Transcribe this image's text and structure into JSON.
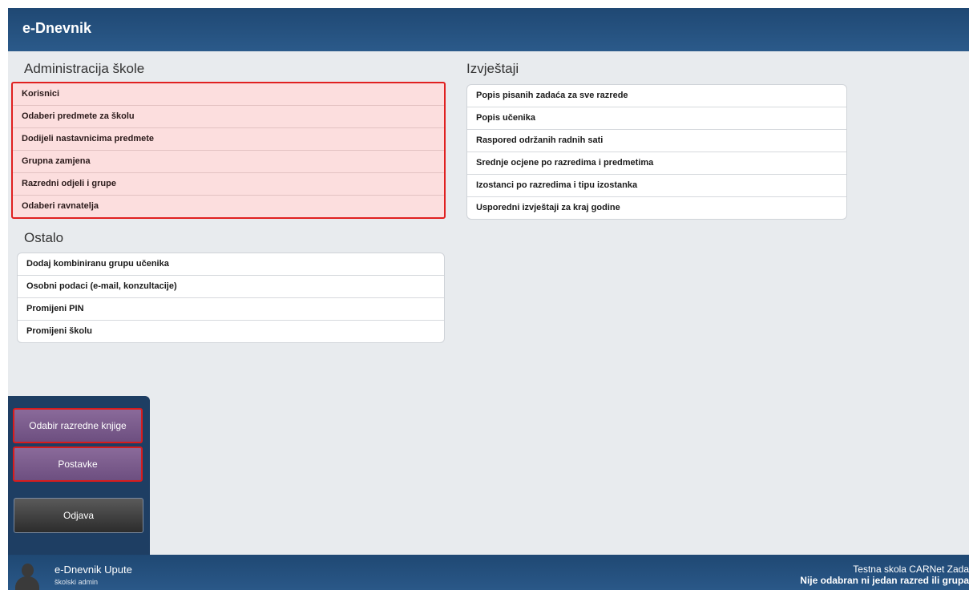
{
  "header": {
    "title": "e-Dnevnik"
  },
  "administracija": {
    "title": "Administracija škole",
    "items": [
      "Korisnici",
      "Odaberi predmete za školu",
      "Dodijeli nastavnicima predmete",
      "Grupna zamjena",
      "Razredni odjeli i grupe",
      "Odaberi ravnatelja"
    ]
  },
  "ostalo": {
    "title": "Ostalo",
    "items": [
      "Dodaj kombiniranu grupu učenika",
      "Osobni podaci (e-mail, konzultacije)",
      "Promijeni PIN",
      "Promijeni školu"
    ]
  },
  "izvjestaji": {
    "title": "Izvještaji",
    "items": [
      "Popis pisanih zadaća za sve razrede",
      "Popis učenika",
      "Raspored održanih radnih sati",
      "Srednje ocjene po razredima i predmetima",
      "Izostanci po razredima i tipu izostanka",
      "Usporedni izvještaji za kraj godine"
    ]
  },
  "sidebar": {
    "odabir_label": "Odabir razredne knjige",
    "postavke_label": "Postavke",
    "odjava_label": "Odjava"
  },
  "footer": {
    "user_name": "e-Dnevnik Upute",
    "user_role": "školski admin",
    "school": "Testna skola CARNet Zada",
    "class_status": "Nije odabran ni jedan razred ili grupa"
  },
  "colors": {
    "header_blue": "#1f4873",
    "highlight_red": "#e02020",
    "highlight_pink": "#fcdede",
    "button_purple": "#7a5c8c"
  }
}
